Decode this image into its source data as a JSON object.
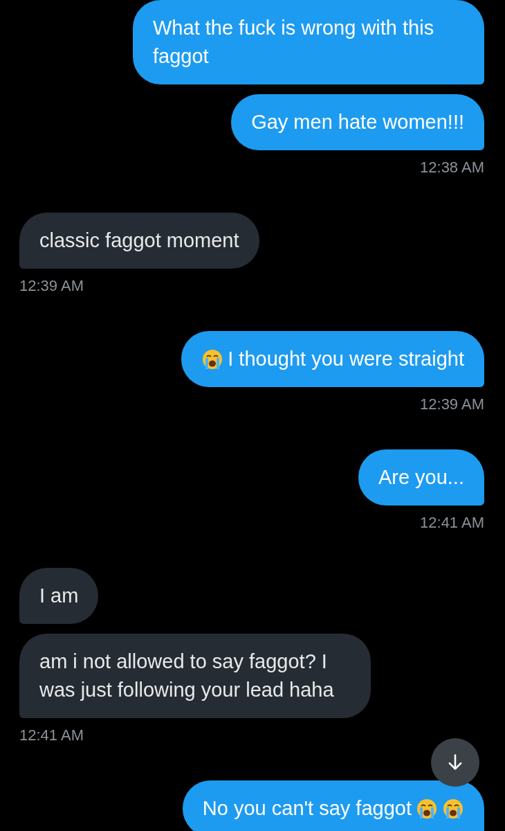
{
  "conversation": [
    {
      "kind": "message",
      "outgoing": true,
      "segments": [
        {
          "kind": "text",
          "text": "What the fuck is wrong with this faggot"
        }
      ]
    },
    {
      "kind": "message",
      "outgoing": true,
      "segments": [
        {
          "kind": "text",
          "text": "Gay men hate women!!!"
        }
      ]
    },
    {
      "kind": "time",
      "outgoing": true,
      "text": "12:38 AM"
    },
    {
      "kind": "message",
      "outgoing": false,
      "segments": [
        {
          "kind": "text",
          "text": "classic faggot moment"
        }
      ]
    },
    {
      "kind": "time",
      "outgoing": false,
      "text": "12:39 AM"
    },
    {
      "kind": "message",
      "outgoing": true,
      "segments": [
        {
          "kind": "emoji"
        },
        {
          "kind": "text",
          "text": "I thought you were straight"
        }
      ]
    },
    {
      "kind": "time",
      "outgoing": true,
      "text": "12:39 AM"
    },
    {
      "kind": "message",
      "outgoing": true,
      "segments": [
        {
          "kind": "text",
          "text": "Are you..."
        }
      ]
    },
    {
      "kind": "time",
      "outgoing": true,
      "text": "12:41 AM"
    },
    {
      "kind": "message",
      "outgoing": false,
      "segments": [
        {
          "kind": "text",
          "text": "I am"
        }
      ]
    },
    {
      "kind": "message",
      "outgoing": false,
      "segments": [
        {
          "kind": "text",
          "text": "am i not allowed to say faggot? I was just following your lead haha"
        }
      ]
    },
    {
      "kind": "time",
      "outgoing": false,
      "text": "12:41 AM"
    },
    {
      "kind": "message",
      "outgoing": true,
      "segments": [
        {
          "kind": "text",
          "text": "No you can't say faggot"
        },
        {
          "kind": "emoji"
        },
        {
          "kind": "emoji"
        }
      ]
    }
  ]
}
